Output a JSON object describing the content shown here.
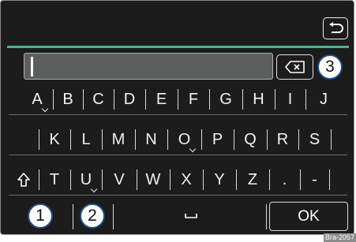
{
  "keyboard": {
    "row1": [
      "A",
      "B",
      "C",
      "D",
      "E",
      "F",
      "G",
      "H",
      "I",
      "J"
    ],
    "row2": [
      "K",
      "L",
      "M",
      "N",
      "O",
      "P",
      "Q",
      "R",
      "S"
    ],
    "row3": [
      "T",
      "U",
      "V",
      "W",
      "X",
      "Y",
      "Z",
      ".",
      "-"
    ],
    "accent_keys": [
      "A",
      "O",
      "U"
    ],
    "ok_label": "OK"
  },
  "icons": {
    "back": "back-arrow-icon",
    "delete": "backspace-icon",
    "shift": "shift-arrow-icon",
    "space": "space-bar-icon"
  },
  "callouts": {
    "one": "1",
    "two": "2",
    "three": "3"
  },
  "figure_id": "Bra-2057",
  "colors": {
    "screen_bg": "#1b1c1b",
    "accent_line": "#4fb28a",
    "callout_border": "#1c4b87",
    "text_field": "#5c5e5d"
  }
}
